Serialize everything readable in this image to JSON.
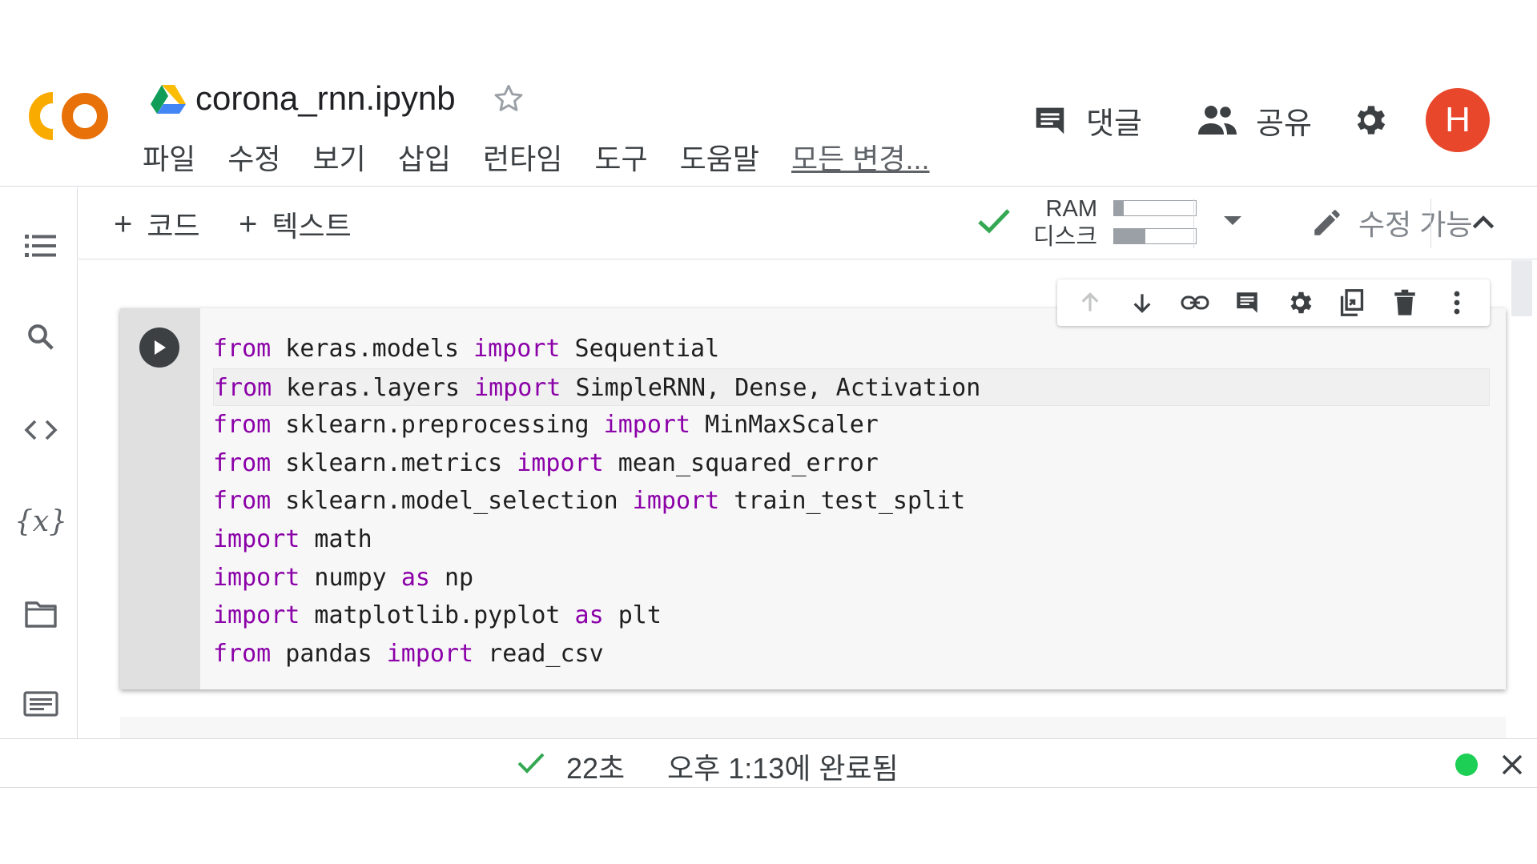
{
  "header": {
    "doc_title": "corona_rnn.ipynb",
    "menu": [
      "파일",
      "수정",
      "보기",
      "삽입",
      "런타임",
      "도구",
      "도움말"
    ],
    "changes_label": "모든 변경...",
    "comment_label": "댓글",
    "share_label": "공유",
    "avatar_letter": "H",
    "avatar_color": "#e8472b"
  },
  "toolbar": {
    "add_code": "코드",
    "add_text": "텍스트",
    "ram_label": "RAM",
    "disk_label": "디스크",
    "ram_usage": 0.12,
    "disk_usage": 0.38,
    "edit_mode": "수정 가능"
  },
  "sidebar": {
    "icons": [
      "toc-icon",
      "search-icon",
      "code-snippets-icon",
      "variables-icon",
      "files-icon",
      "terminal-icon"
    ],
    "variables_glyph": "{x}"
  },
  "cell": {
    "lines": [
      [
        [
          "kw",
          "from"
        ],
        [
          "t",
          " keras.models "
        ],
        [
          "kw",
          "import"
        ],
        [
          "t",
          " Sequential"
        ]
      ],
      [
        [
          "kw",
          "from"
        ],
        [
          "t",
          " keras.layers "
        ],
        [
          "kw",
          "import"
        ],
        [
          "t",
          " SimpleRNN, Dense, Activation"
        ]
      ],
      [
        [
          "kw",
          "from"
        ],
        [
          "t",
          " sklearn.preprocessing "
        ],
        [
          "kw",
          "import"
        ],
        [
          "t",
          " MinMaxScaler"
        ]
      ],
      [
        [
          "kw",
          "from"
        ],
        [
          "t",
          " sklearn.metrics "
        ],
        [
          "kw",
          "import"
        ],
        [
          "t",
          " mean_squared_error"
        ]
      ],
      [
        [
          "kw",
          "from"
        ],
        [
          "t",
          " sklearn.model_selection "
        ],
        [
          "kw",
          "import"
        ],
        [
          "t",
          " train_test_split"
        ]
      ],
      [
        [
          "kw",
          "import"
        ],
        [
          "t",
          " math"
        ]
      ],
      [
        [
          "kw",
          "import"
        ],
        [
          "t",
          " numpy "
        ],
        [
          "kw",
          "as"
        ],
        [
          "t",
          " np"
        ]
      ],
      [
        [
          "kw",
          "import"
        ],
        [
          "t",
          " matplotlib.pyplot "
        ],
        [
          "kw",
          "as"
        ],
        [
          "t",
          " plt"
        ]
      ],
      [
        [
          "kw",
          "from"
        ],
        [
          "t",
          " pandas "
        ],
        [
          "kw",
          "import"
        ],
        [
          "t",
          " read_csv"
        ]
      ]
    ],
    "active_line": 1
  },
  "status": {
    "duration": "22초",
    "completed": "오후 1:13에 완료됨",
    "connected_color": "#1ecf55"
  }
}
